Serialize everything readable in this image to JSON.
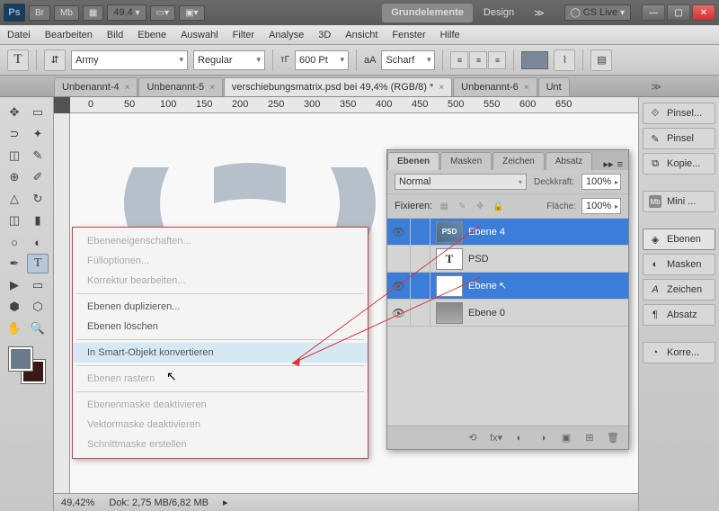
{
  "titlebar": {
    "zoom": "49,4",
    "workspaces": [
      "Grundelemente",
      "Design"
    ],
    "cslive": "CS Live"
  },
  "menubar": [
    "Datei",
    "Bearbeiten",
    "Bild",
    "Ebene",
    "Auswahl",
    "Filter",
    "Analyse",
    "3D",
    "Ansicht",
    "Fenster",
    "Hilfe"
  ],
  "options": {
    "font": "Army",
    "style": "Regular",
    "size": "600 Pt",
    "aa_label": "aA",
    "aa": "Scharf"
  },
  "doc_tabs": [
    {
      "label": "Unbenannt-4",
      "active": false
    },
    {
      "label": "Unbenannt-5",
      "active": false
    },
    {
      "label": "verschiebungsmatrix.psd bei 49,4% (RGB/8) *",
      "active": true
    },
    {
      "label": "Unbenannt-6",
      "active": false
    },
    {
      "label": "Unt",
      "active": false
    }
  ],
  "ruler_marks": [
    "0",
    "50",
    "100",
    "150",
    "200",
    "250",
    "300",
    "350",
    "400",
    "450",
    "500",
    "550",
    "600",
    "650"
  ],
  "context_menu": [
    {
      "label": "Ebeneneigenschaften...",
      "disabled": true
    },
    {
      "label": "Fülloptionen...",
      "disabled": true
    },
    {
      "label": "Korrektur bearbeiten...",
      "disabled": true
    },
    {
      "sep": true
    },
    {
      "label": "Ebenen duplizieren..."
    },
    {
      "label": "Ebenen löschen"
    },
    {
      "sep": true
    },
    {
      "label": "In Smart-Objekt konvertieren",
      "hover": true
    },
    {
      "sep": true
    },
    {
      "label": "Ebenen rastern",
      "disabled": true
    },
    {
      "sep": true
    },
    {
      "label": "Ebenenmaske deaktivieren",
      "disabled": true
    },
    {
      "label": "Vektormaske deaktivieren",
      "disabled": true
    },
    {
      "label": "Schnittmaske erstellen",
      "disabled": true
    }
  ],
  "layers_panel": {
    "tabs": [
      "Ebenen",
      "Masken",
      "Zeichen",
      "Absatz"
    ],
    "blend": "Normal",
    "opacity_label": "Deckkraft:",
    "opacity": "100%",
    "lock_label": "Fixieren:",
    "fill_label": "Fläche:",
    "fill": "100%",
    "layers": [
      {
        "name": "Ebene 4",
        "thumb": "psd",
        "selected": true,
        "visible": true
      },
      {
        "name": "PSD",
        "thumb": "T",
        "selected": false,
        "visible": false
      },
      {
        "name": "Ebene",
        "thumb": "white",
        "selected": true,
        "visible": true,
        "cursor": true
      },
      {
        "name": "Ebene 0",
        "thumb": "img",
        "selected": false,
        "visible": true
      }
    ]
  },
  "right_panels": [
    {
      "label": "Pinsel...",
      "icon": "⟐"
    },
    {
      "label": "Pinsel",
      "icon": "✎"
    },
    {
      "label": "Kopie...",
      "icon": "⧉"
    },
    {
      "label": "Mini ...",
      "icon": "Mb",
      "boxed": true
    },
    {
      "label": "Ebenen",
      "icon": "◈",
      "active": true
    },
    {
      "label": "Masken",
      "icon": "◐"
    },
    {
      "label": "Zeichen",
      "icon": "A"
    },
    {
      "label": "Absatz",
      "icon": "¶"
    },
    {
      "label": "Korre...",
      "icon": "◔"
    }
  ],
  "status": {
    "zoom": "49,42%",
    "doc": "Dok: 2,75 MB/6,82 MB"
  }
}
